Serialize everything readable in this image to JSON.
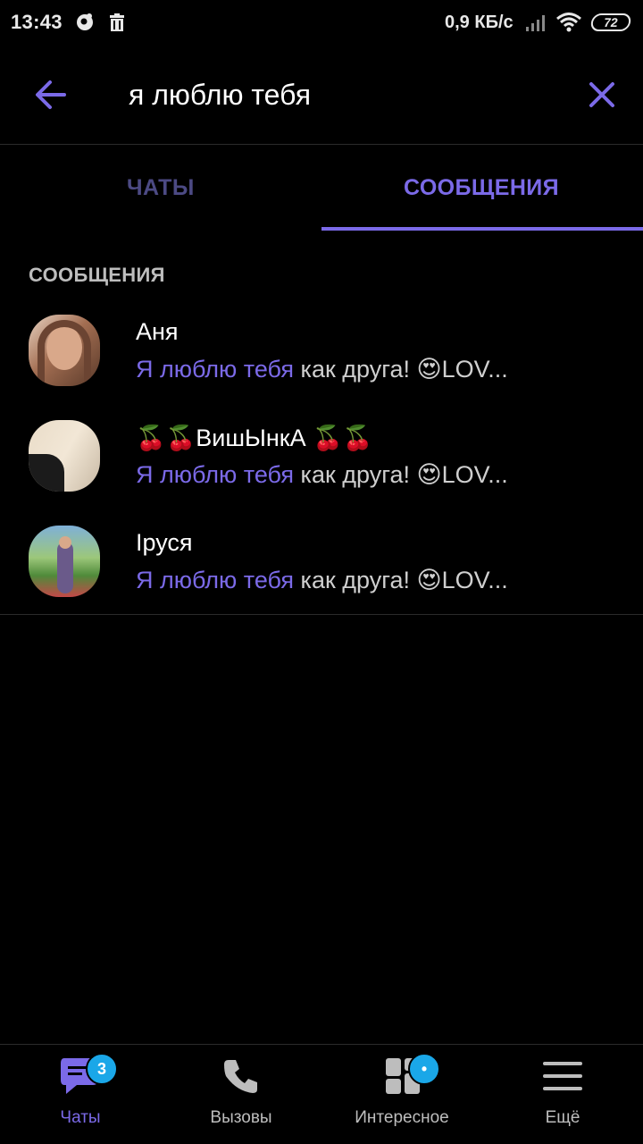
{
  "status_bar": {
    "time": "13:43",
    "network_speed": "0,9 КБ/с",
    "battery": "72"
  },
  "search": {
    "query": "я люблю тебя"
  },
  "tabs": [
    {
      "label": "ЧАТЫ",
      "active": false
    },
    {
      "label": "СООБЩЕНИЯ",
      "active": true
    }
  ],
  "section_label": "СООБЩЕНИЯ",
  "results": [
    {
      "name": "Аня",
      "highlight": "Я люблю тебя",
      "rest": " как друга! 😍LOV..."
    },
    {
      "name": "🍒🍒ВишЫнкА 🍒🍒",
      "highlight": "Я люблю тебя",
      "rest": " как друга! 😍LOV..."
    },
    {
      "name": "Іруся",
      "highlight": "Я люблю тебя",
      "rest": " как друга! 😍LOV..."
    }
  ],
  "bottom_nav": [
    {
      "label": "Чаты",
      "icon": "chat-bubble-icon",
      "badge": "3",
      "active": true
    },
    {
      "label": "Вызовы",
      "icon": "phone-icon",
      "active": false
    },
    {
      "label": "Интересное",
      "icon": "explore-grid-icon",
      "badge": "•",
      "active": false
    },
    {
      "label": "Ещё",
      "icon": "menu-icon",
      "active": false
    }
  ],
  "colors": {
    "accent": "#7b6ae8",
    "badge": "#1aa7e8",
    "background": "#000000"
  }
}
